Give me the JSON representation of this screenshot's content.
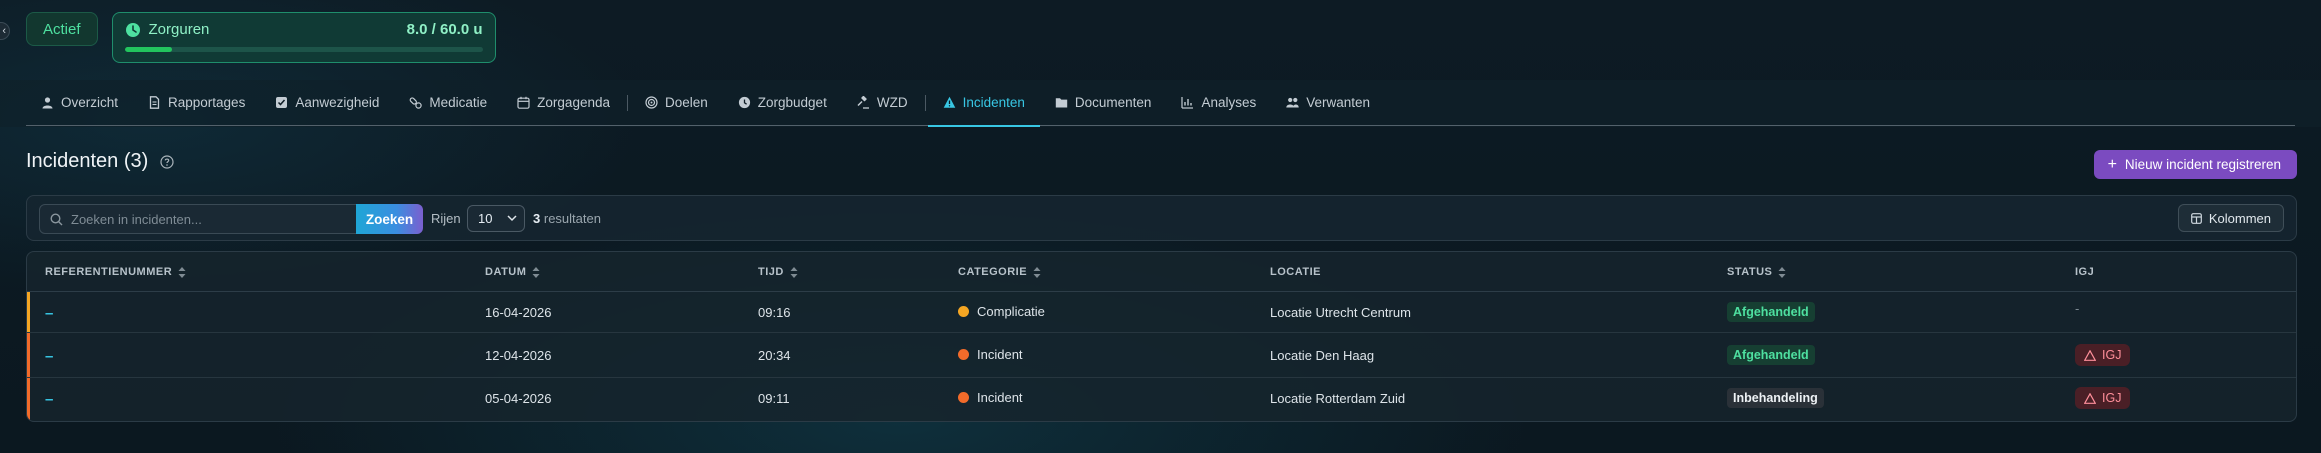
{
  "header": {
    "status": "Actief",
    "hours_label": "Zorguren",
    "hours_value": "8.0 / 60.0 u",
    "hours_progress": 0.133
  },
  "tabs": [
    {
      "label": "Overzicht",
      "icon": "user-icon"
    },
    {
      "label": "Rapportages",
      "icon": "document-icon"
    },
    {
      "label": "Aanwezigheid",
      "icon": "checkbox-icon"
    },
    {
      "label": "Medicatie",
      "icon": "pills-icon"
    },
    {
      "label": "Zorgagenda",
      "icon": "calendar-icon"
    },
    {
      "label": "Doelen",
      "icon": "target-icon"
    },
    {
      "label": "Zorgbudget",
      "icon": "coin-icon"
    },
    {
      "label": "WZD",
      "icon": "gavel-icon"
    },
    {
      "label": "Incidenten",
      "icon": "warning-icon",
      "active": true
    },
    {
      "label": "Documenten",
      "icon": "folder-icon"
    },
    {
      "label": "Analyses",
      "icon": "chart-icon"
    },
    {
      "label": "Verwanten",
      "icon": "people-icon"
    }
  ],
  "section": {
    "title": "Incidenten (3)",
    "new_button": "Nieuw incident registreren"
  },
  "toolbar": {
    "search_placeholder": "Zoeken in incidenten...",
    "search_button": "Zoeken",
    "rows_label": "Rijen",
    "rows_value": "10",
    "results_count": "3",
    "results_label": "resultaten",
    "columns_button": "Kolommen"
  },
  "table": {
    "headers": {
      "ref": "REFERENTIENUMMER",
      "date": "DATUM",
      "time": "TIJD",
      "category": "CATEGORIE",
      "location": "LOCATIE",
      "status": "STATUS",
      "igj": "IGJ"
    },
    "rows": [
      {
        "ref": "–",
        "date": "16-04-2026",
        "time": "09:16",
        "category": "Complicatie",
        "category_color": "#f5a623",
        "location": "Locatie Utrecht Centrum",
        "status": "Afgehandeld",
        "igj": "-",
        "accent": "#f5a623"
      },
      {
        "ref": "–",
        "date": "12-04-2026",
        "time": "20:34",
        "category": "Incident",
        "category_color": "#f26b2a",
        "location": "Locatie Den Haag",
        "status": "Afgehandeld",
        "igj": "IGJ",
        "accent": "#f26b2a"
      },
      {
        "ref": "–",
        "date": "05-04-2026",
        "time": "09:11",
        "category": "Incident",
        "category_color": "#f26b2a",
        "location": "Locatie Rotterdam Zuid",
        "status": "Inbehandeling",
        "igj": "IGJ",
        "accent": "#f26b2a"
      }
    ]
  },
  "colors": {
    "accent": "#38c7e4",
    "primary_button": "#7b4bc0",
    "success": "#4ee0a0",
    "danger": "#ff8f9a"
  }
}
